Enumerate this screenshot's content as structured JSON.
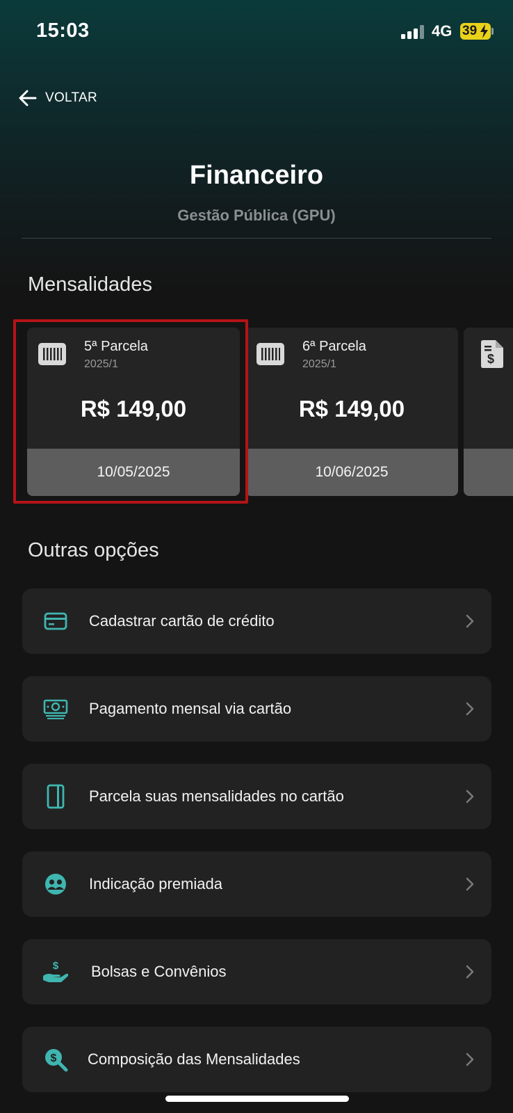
{
  "status_bar": {
    "time": "15:03",
    "network": "4G",
    "battery_level": "39",
    "battery_color": "#e9d21a"
  },
  "header": {
    "back_label": "VOLTAR",
    "back_icon": "arrow-left-icon",
    "title": "Financeiro",
    "subtitle": "Gestão Pública (GPU)"
  },
  "installments": {
    "section_title": "Mensalidades",
    "cards": [
      {
        "label": "5ª Parcela",
        "term": "2025/1",
        "amount": "R$ 149,00",
        "due_date": "10/05/2025",
        "icon": "barcode-icon",
        "selected": true
      },
      {
        "label": "6ª Parcela",
        "term": "2025/1",
        "amount": "R$ 149,00",
        "due_date": "10/06/2025",
        "icon": "barcode-icon",
        "selected": false
      },
      {
        "icon": "invoice-dollar-icon"
      }
    ]
  },
  "other_options": {
    "section_title": "Outras opções",
    "items": [
      {
        "label": "Cadastrar cartão de crédito",
        "icon": "credit-card-icon"
      },
      {
        "label": "Pagamento mensal via cartão",
        "icon": "cash-icon"
      },
      {
        "label": "Parcela suas mensalidades no cartão",
        "icon": "card-vertical-icon"
      },
      {
        "label": "Indicação premiada",
        "icon": "users-circle-icon"
      },
      {
        "label": "Bolsas e Convênios",
        "icon": "hand-dollar-icon"
      },
      {
        "label": "Composição das Mensalidades",
        "icon": "search-dollar-icon"
      }
    ]
  },
  "colors": {
    "accent": "#3fb6b0",
    "highlight": "#b51318",
    "card_bg": "#242424",
    "due_bar": "#5d5d5d"
  }
}
